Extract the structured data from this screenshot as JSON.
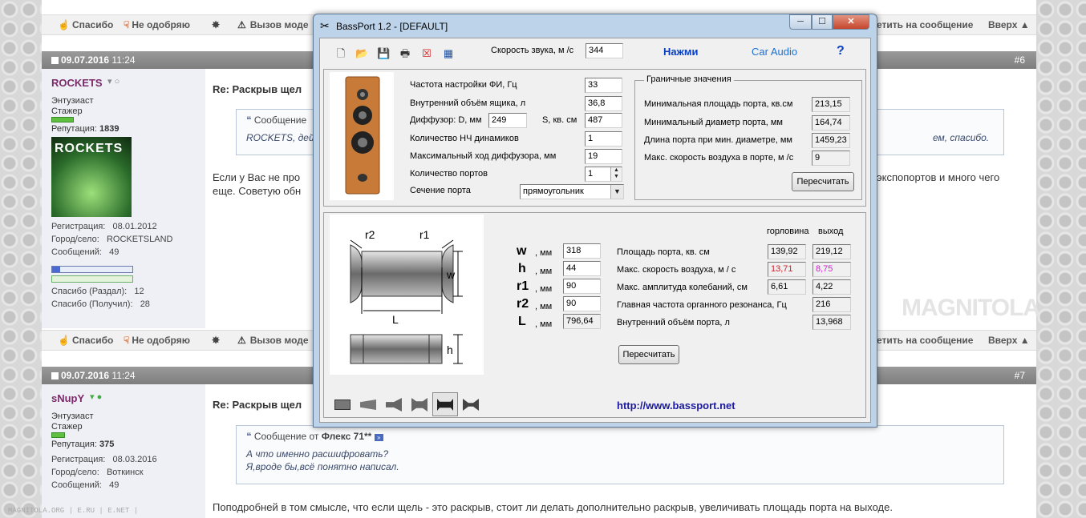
{
  "forum": {
    "actions": {
      "thanks": "Спасибо",
      "disapprove": "Не одобряю",
      "call_mod": "Вызов моде",
      "reply": "етить на сообщение",
      "up": "Вверх ▲"
    },
    "post6": {
      "date": "09.07.2016",
      "time": "11:24",
      "number": "#6",
      "user": "ROCKETS",
      "rank1": "Энтузиаст",
      "rank2": "Стажер",
      "rep_label": "Репутация:",
      "rep_value": "1839",
      "avatar_text": "ROCKETS",
      "reg_label": "Регистрация:",
      "reg_value": "08.01.2012",
      "city_label": "Город/село:",
      "city_value": "ROCKETSLAND",
      "msgs_label": "Сообщений:",
      "msgs_value": "49",
      "thanks_given_label": "Спасибо (Раздал):",
      "thanks_given": "12",
      "thanks_got_label": "Спасибо (Получил):",
      "thanks_got": "28",
      "title": "Re: Раскрыв щел",
      "quote_header": "Сообщение",
      "quote_text": "ROCKETS, дей",
      "quote_tail": "ем, спасибо.",
      "text1": "Если у Вас не про",
      "text1_tail": "экспопортов и много чего",
      "text2": "еще. Советую обн"
    },
    "post7": {
      "date": "09.07.2016",
      "time": "11:24",
      "number": "#7",
      "user": "sNupY",
      "rank1": "Энтузиаст",
      "rank2": "Стажер",
      "rep_label": "Репутация:",
      "rep_value": "375",
      "reg_label": "Регистрация:",
      "reg_value": "08.03.2016",
      "city_label": "Город/село:",
      "city_value": "Воткинск",
      "msgs_label": "Сообщений:",
      "msgs_value": "49",
      "title": "Re: Раскрыв щел",
      "quote_header_pre": "Сообщение от",
      "quote_author": "Флекс 71**",
      "quote_line1": "А что именно расшифровать?",
      "quote_line2": "Я,вроде бы,всё понятно написал.",
      "text": "Поподробней в том смысле, что если щель - это раскрыв, стоит ли делать дополнительно раскрыв, увеличивать площадь порта на выходе."
    },
    "watermark": "MAGNITOLA",
    "footer_watermark": "MAGNITOLA.ORG | E.RU | E.NET |"
  },
  "app": {
    "title": "BassPort 1.2 - [DEFAULT]",
    "window_buttons": {
      "min": "─",
      "max": "☐",
      "close": "✕"
    },
    "sound_speed_label": "Скорость звука, м /с",
    "sound_speed": "344",
    "press_link": "Нажми",
    "car_audio_link": "Car Audio",
    "help": "?",
    "params": {
      "tuning_label": "Частота настройки ФИ, Гц",
      "tuning": "33",
      "volume_label": "Внутренний объём ящика, л",
      "volume": "36,8",
      "diffuser_label": "Диффузор: D, мм",
      "diffuser_d": "249",
      "area_label": "S, кв. см",
      "area_s": "487",
      "drivers_label": "Количество НЧ динамиков",
      "drivers": "1",
      "xmax_label": "Максимальный ход диффузора, мм",
      "xmax": "19",
      "ports_label": "Количество портов",
      "ports": "1",
      "section_label": "Сечение порта",
      "section": "прямоугольник"
    },
    "limits": {
      "title": "Граничные значения",
      "min_area_label": "Минимальная площадь порта, кв.см",
      "min_area": "213,15",
      "min_diam_label": "Минимальный диаметр порта, мм",
      "min_diam": "164,74",
      "len_label": "Длина порта при мин. диаметре, мм",
      "len": "1459,23",
      "max_speed_label": "Макс. скорость воздуха в порте, м /с",
      "max_speed": "9",
      "recalc": "Пересчитать"
    },
    "port": {
      "diagram": {
        "r2": "r2",
        "r1": "r1",
        "w": "w",
        "L": "L",
        "h": "h"
      },
      "w_letter": "w",
      "h_letter": "h",
      "r1_letter": "r1",
      "r2_letter": "r2",
      "L_letter": "L",
      "unit": ", мм",
      "w": "318",
      "h": "44",
      "r1": "90",
      "r2": "90",
      "L": "796,64",
      "col_throat": "горловина",
      "col_exit": "выход",
      "area_label": "Площадь порта, кв. см",
      "area_throat": "139,92",
      "area_exit": "219,12",
      "speed_label": "Макс. скорость воздуха, м / с",
      "speed_throat": "13,71",
      "speed_exit": "8,75",
      "ampl_label": "Макс. амплитуда колебаний, см",
      "ampl_throat": "6,61",
      "ampl_exit": "4,22",
      "organ_label": "Главная частота органного резонанса, Гц",
      "organ": "216",
      "vol_label": "Внутренний объём порта, л",
      "vol": "13,968",
      "recalc": "Пересчитать",
      "url": "http://www.bassport.net"
    },
    "colors": {
      "red": "#d0202a",
      "magenta": "#d020d0",
      "link": "#0b40c0"
    }
  }
}
